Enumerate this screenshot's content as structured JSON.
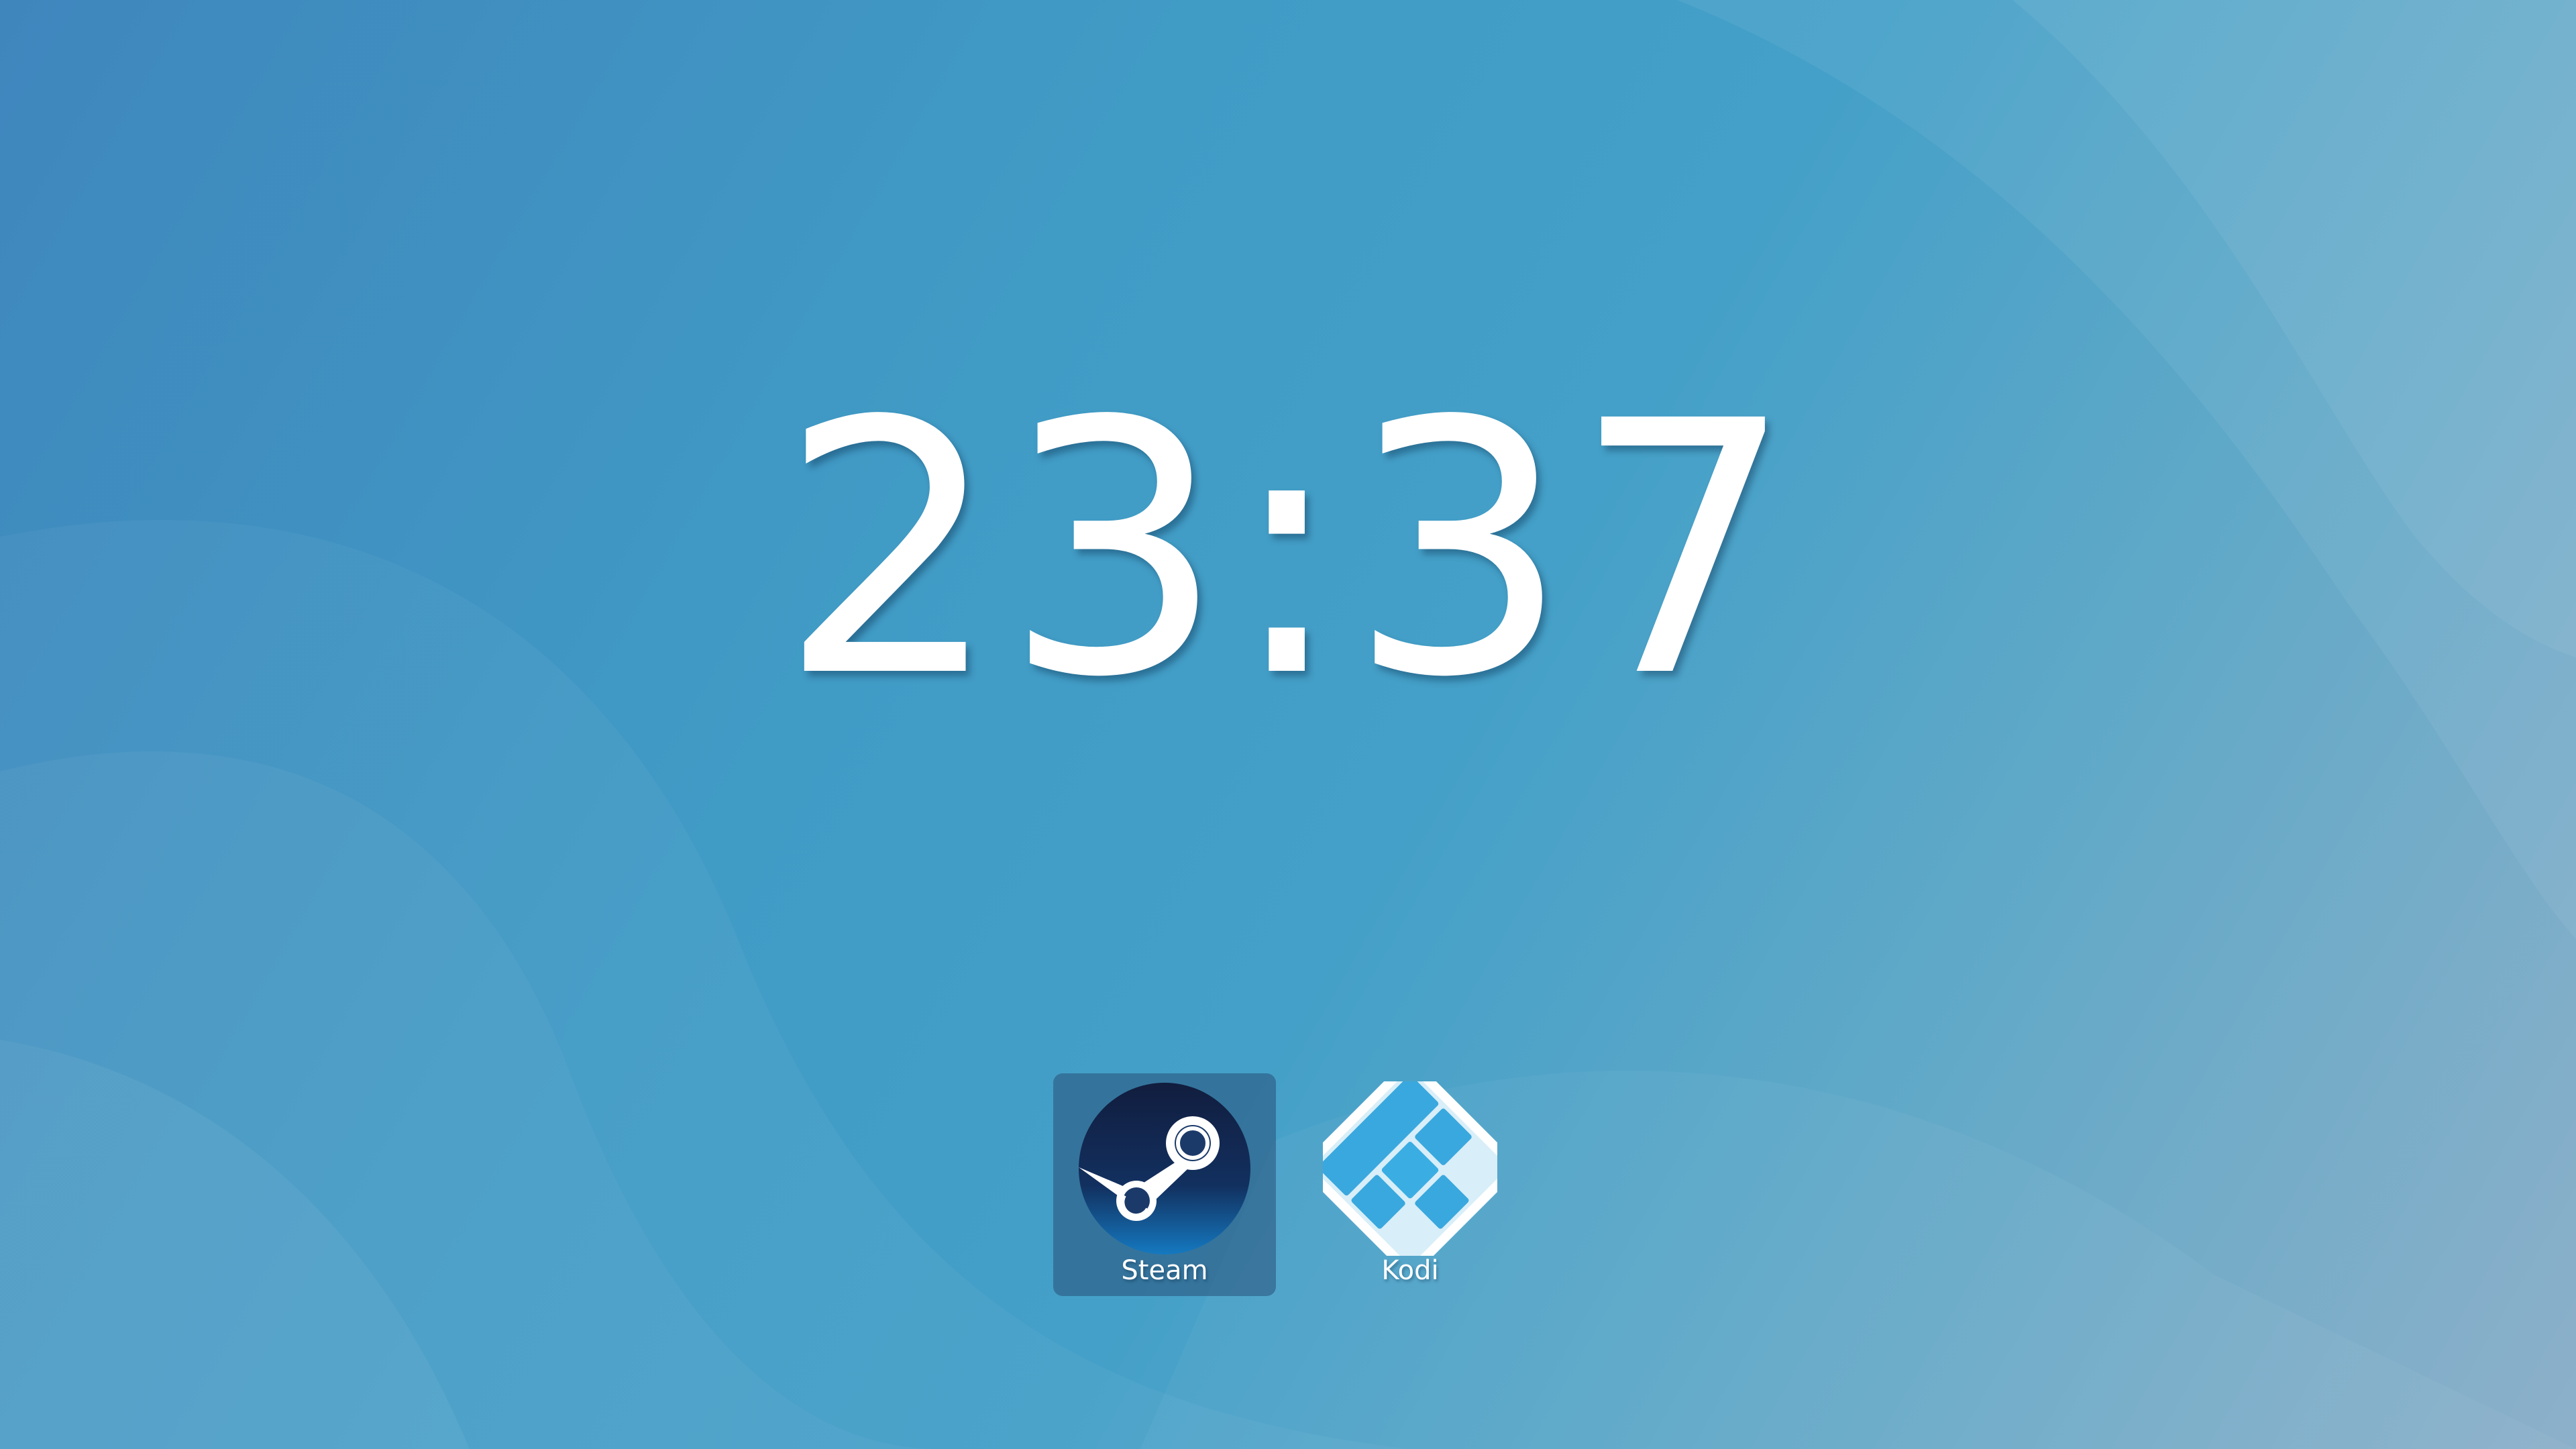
{
  "clock": {
    "time": "23:37"
  },
  "apps": [
    {
      "label": "Steam",
      "icon": "steam-icon",
      "selected": true
    },
    {
      "label": "Kodi",
      "icon": "kodi-icon",
      "selected": false
    }
  ],
  "colors": {
    "background_start": "#3f86bd",
    "background_end": "#8db0c9",
    "selection": "#2f5f86",
    "kodi_blue": "#3aaee3",
    "steam_dark": "#0f2147"
  }
}
